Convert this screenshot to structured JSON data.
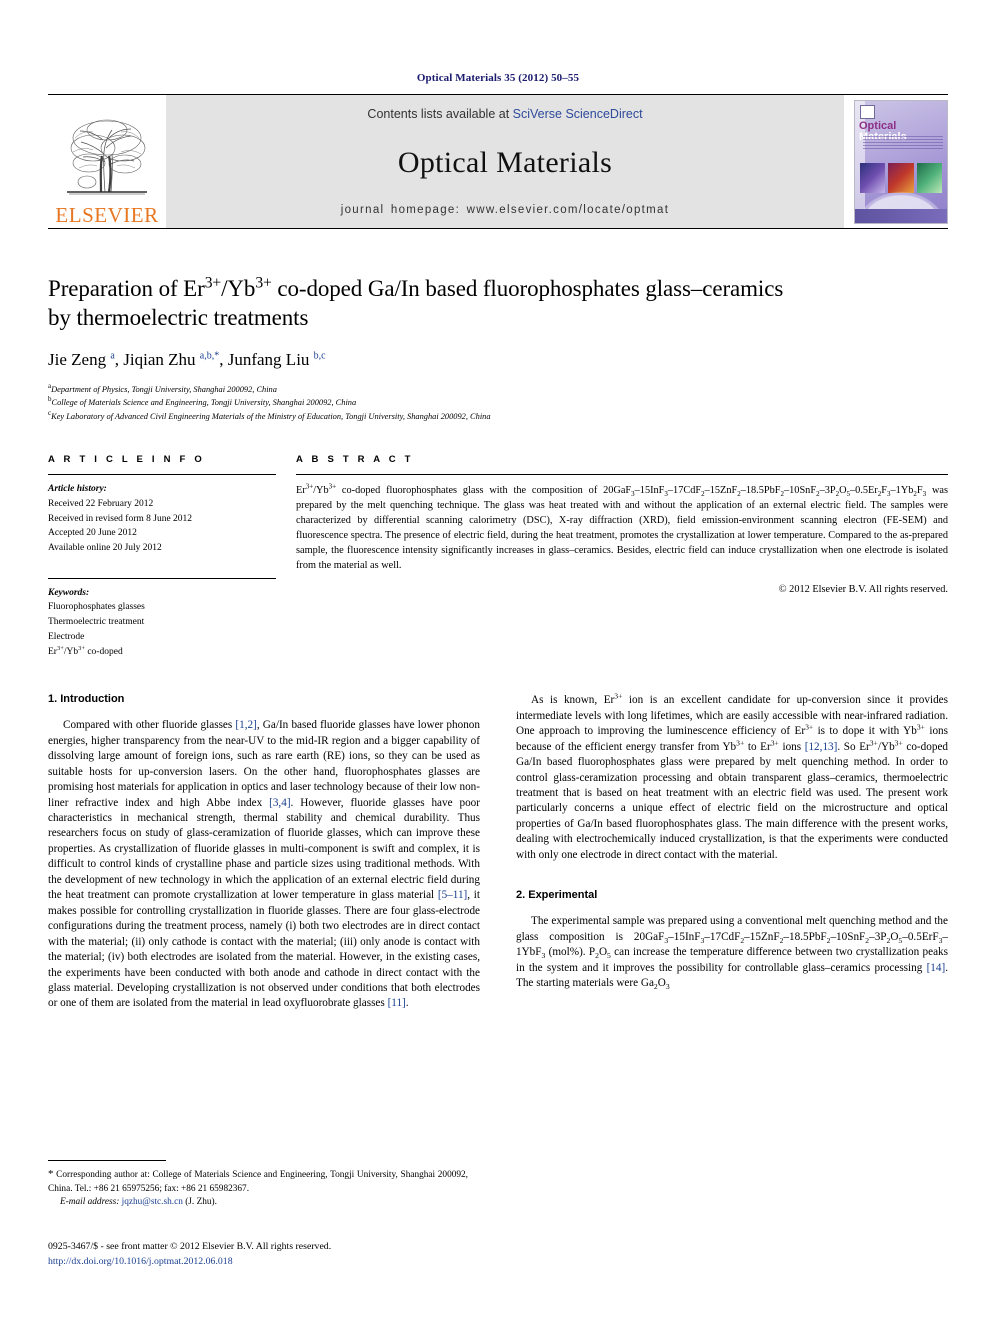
{
  "running_head": "Optical Materials 35 (2012) 50–55",
  "banner": {
    "contents_prefix": "Contents lists available at ",
    "sciencedirect": "SciVerse ScienceDirect",
    "journal_name": "Optical Materials",
    "homepage": "journal homepage: www.elsevier.com/locate/optmat",
    "publisher_logo_text": "ELSEVIER",
    "cover_title_part1": "Optical ",
    "cover_title_part2": "Materials",
    "accent_color": "#E87722",
    "link_color": "#2e4b9b",
    "banner_bg": "#e3e3e3"
  },
  "article": {
    "title_line1": "Preparation of Er<sup>3+</sup>/Yb<sup>3+</sup> co-doped Ga/In based fluorophosphates glass–ceramics",
    "title_line2": "by thermoelectric treatments",
    "authors_html": "Jie Zeng <sup>a</sup>, Jiqian Zhu <sup>a,b,</sup><sup>*</sup>, Junfang Liu <sup>b,c</sup>",
    "affiliations": [
      "<sup>a</sup>Department of Physics, Tongji University, Shanghai 200092, China",
      "<sup>b</sup>College of Materials Science and Engineering, Tongji University, Shanghai 200092, China",
      "<sup>c</sup>Key Laboratory of Advanced Civil Engineering Materials of the Ministry of Education, Tongji University, Shanghai 200092, China"
    ]
  },
  "article_info": {
    "heading": "A R T I C L E    I N F O",
    "history_label": "Article history:",
    "history": [
      "Received 22 February 2012",
      "Received in revised form 8 June 2012",
      "Accepted 20 June 2012",
      "Available online 20 July 2012"
    ],
    "keywords_label": "Keywords:",
    "keywords_html": [
      "Fluorophosphates glasses",
      "Thermoelectric treatment",
      "Electrode",
      "Er<sup>3+</sup>/Yb<sup>3+</sup> co-doped"
    ]
  },
  "abstract": {
    "heading": "A B S T R A C T",
    "text_html": "Er<sup>3+</sup>/Yb<sup>3+</sup> co-doped fluorophosphates glass with the composition of 20GaF<sub>3</sub>–15InF<sub>3</sub>–17CdF<sub>2</sub>–15ZnF<sub>2</sub>–18.5PbF<sub>2</sub>–10SnF<sub>2</sub>–3P<sub>2</sub>O<sub>5</sub>–0.5Er<sub>2</sub>F<sub>3</sub>–1Yb<sub>2</sub>F<sub>3</sub> was prepared by the melt quenching technique. The glass was heat treated with and without the application of an external electric field. The samples were characterized by differential scanning calorimetry (DSC), X-ray diffraction (XRD), field emission-environment scanning electron (FE-SEM) and fluorescence spectra. The presence of electric field, during the heat treatment, promotes the crystallization at lower temperature. Compared to the as-prepared sample, the fluorescence intensity significantly increases in glass–ceramics. Besides, electric field can induce crystallization when one electrode is isolated from the material as well.",
    "copyright": "© 2012 Elsevier B.V. All rights reserved."
  },
  "sections": {
    "intro_heading": "1. Introduction",
    "experimental_heading": "2. Experimental",
    "intro_p1_html": "Compared with other fluoride glasses <span class=\"ref\">[1,2]</span>, Ga/In based fluoride glasses have lower phonon energies, higher transparency from the near-UV to the mid-IR region and a bigger capability of dissolving large amount of foreign ions, such as rare earth (RE) ions, so they can be used as suitable hosts for up-conversion lasers. On the other hand, fluorophosphates glasses are promising host materials for application in optics and laser technology because of their low non-liner refractive index and high Abbe index <span class=\"ref\">[3,4]</span>. However, fluoride glasses have poor characteristics in mechanical strength, thermal stability and chemical durability. Thus researchers focus on study of glass-ceramization of fluoride glasses, which can improve these properties. As crystallization of fluoride glasses in multi-component is swift and complex, it is difficult to control kinds of crystalline phase and particle sizes using traditional methods. With the development of new technology in which the application of an external electric field during the heat treatment can promote crystallization at lower temperature in glass material <span class=\"ref\">[5–11]</span>, it makes possible for controlling crystallization in fluoride glasses. There are four glass-electrode configurations during the treatment process, namely (i) both two electrodes are in direct contact with the material; (ii) only cathode is contact with the material; (iii) only anode is contact with the material; (iv) both electrodes are isolated from the material. However, in the existing cases, the experiments have been conducted with both anode and cathode in direct contact with the glass material. Developing crystallization is not observed under conditions that both electrodes or one of them are isolated from the material in lead oxyfluorobrate glasses <span class=\"ref\">[11]</span>.",
    "intro_p2_html": "As is known, Er<sup>3+</sup> ion is an excellent candidate for up-conversion since it provides intermediate levels with long lifetimes, which are easily accessible with near-infrared radiation. One approach to improving the luminescence efficiency of Er<sup>3+</sup> is to dope it with Yb<sup>3+</sup> ions because of the efficient energy transfer from Yb<sup>3+</sup> to Er<sup>3+</sup> ions <span class=\"ref\">[12,13]</span>. So Er<sup>3+</sup>/Yb<sup>3+</sup> co-doped Ga/In based fluorophosphates glass were prepared by melt quenching method. In order to control glass-ceramization processing and obtain transparent glass–ceramics, thermoelectric treatment that is based on heat treatment with an electric field was used. The present work particularly concerns a unique effect of electric field on the microstructure and optical properties of Ga/In based fluorophosphates glass. The main difference with the present works, dealing with electrochemically induced crystallization, is that the experiments were conducted with only one electrode in direct contact with the material.",
    "experimental_p1_html": "The experimental sample was prepared using a conventional melt quenching method and the glass composition is 20GaF<sub>3</sub>–15InF<sub>3</sub>–17CdF<sub>2</sub>–15ZnF<sub>2</sub>–18.5PbF<sub>2</sub>–10SnF<sub>2</sub>–3P<sub>2</sub>O<sub>5</sub>–0.5ErF<sub>3</sub>–1YbF<sub>3</sub> (mol%). P<sub>2</sub>O<sub>5</sub> can increase the temperature difference between two crystallization peaks in the system and it improves the possibility for controllable glass–ceramics processing <span class=\"ref\">[14]</span>. The starting materials were Ga<sub>2</sub>O<sub>3</sub>"
  },
  "footer": {
    "corresponding_html": "<span style=\"font-size:11px\">*</span> Corresponding author at: College of Materials Science and Engineering, Tongji University, Shanghai 200092, China. Tel.: +86 21 65975256; fax: +86 21 65982367.",
    "email_label": "E-mail address:",
    "email": "jqzhu@stc.sh.cn",
    "email_suffix": "(J. Zhu).",
    "issn_line": "0925-3467/$ - see front matter © 2012 Elsevier B.V. All rights reserved.",
    "doi": "http://dx.doi.org/10.1016/j.optmat.2012.06.018"
  }
}
